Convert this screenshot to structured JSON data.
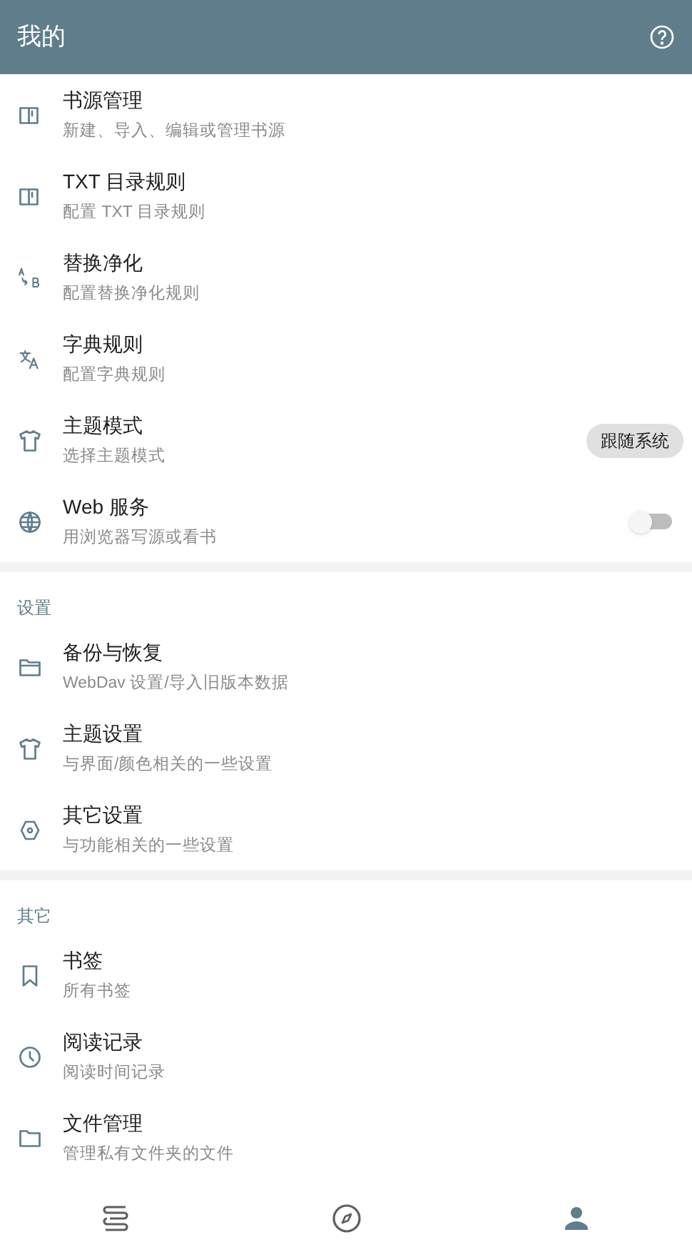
{
  "app_bar": {
    "title": "我的"
  },
  "sections": [
    {
      "items": [
        {
          "title": "书源管理",
          "subtitle": "新建、导入、编辑或管理书源"
        },
        {
          "title": "TXT 目录规则",
          "subtitle": "配置 TXT 目录规则"
        },
        {
          "title": "替换净化",
          "subtitle": "配置替换净化规则"
        },
        {
          "title": "字典规则",
          "subtitle": "配置字典规则"
        },
        {
          "title": "主题模式",
          "subtitle": "选择主题模式",
          "trailing": {
            "kind": "chip",
            "label": "跟随系统"
          }
        },
        {
          "title": "Web 服务",
          "subtitle": "用浏览器写源或看书",
          "trailing": {
            "kind": "switch",
            "on": false
          }
        }
      ]
    },
    {
      "header": "设置",
      "items": [
        {
          "title": "备份与恢复",
          "subtitle": "WebDav 设置/导入旧版本数据"
        },
        {
          "title": "主题设置",
          "subtitle": "与界面/颜色相关的一些设置"
        },
        {
          "title": "其它设置",
          "subtitle": "与功能相关的一些设置"
        }
      ]
    },
    {
      "header": "其它",
      "items": [
        {
          "title": "书签",
          "subtitle": "所有书签"
        },
        {
          "title": "阅读记录",
          "subtitle": "阅读时间记录"
        },
        {
          "title": "文件管理",
          "subtitle": "管理私有文件夹的文件"
        }
      ]
    }
  ],
  "bottom_nav": [
    {
      "selected": false
    },
    {
      "selected": false
    },
    {
      "selected": true
    }
  ]
}
